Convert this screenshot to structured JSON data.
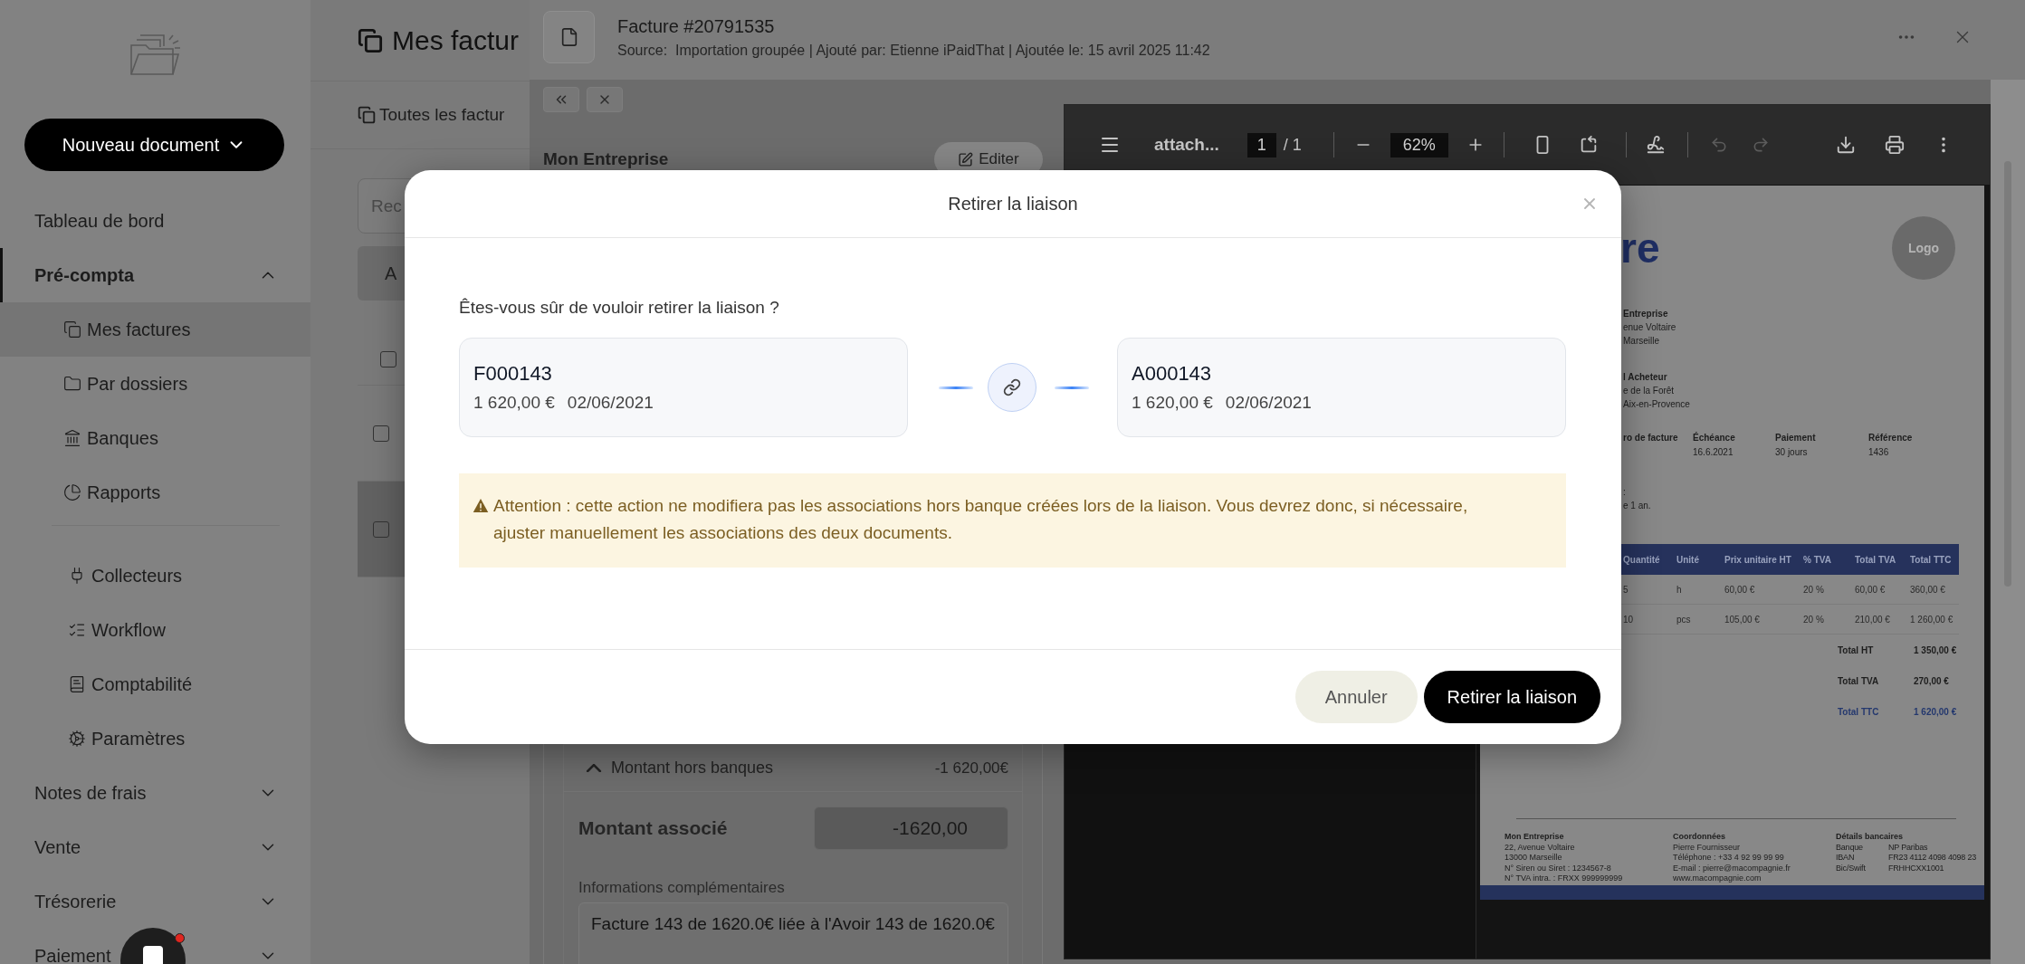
{
  "sidebar": {
    "new_document_button": "Nouveau document",
    "items": [
      {
        "label": "Tableau de bord",
        "kind": "link",
        "selected": false
      },
      {
        "label": "Pré-compta",
        "kind": "section",
        "expanded": true,
        "selected": true,
        "groups": [
          {
            "items": [
              {
                "label": "Mes factures",
                "selected": true
              },
              {
                "label": "Par dossiers",
                "selected": false
              },
              {
                "label": "Banques",
                "selected": false
              },
              {
                "label": "Rapports",
                "selected": false
              }
            ]
          },
          {
            "items": [
              {
                "label": "Collecteurs",
                "selected": false
              },
              {
                "label": "Workflow",
                "selected": false
              },
              {
                "label": "Comptabilité",
                "selected": false
              },
              {
                "label": "Paramètres",
                "selected": false
              }
            ]
          }
        ]
      },
      {
        "label": "Notes de frais",
        "kind": "section",
        "expanded": false,
        "selected": false
      },
      {
        "label": "Vente",
        "kind": "section",
        "expanded": false,
        "selected": false
      },
      {
        "label": "Trésorerie",
        "kind": "section",
        "expanded": false,
        "selected": false
      },
      {
        "label": "Paiement",
        "kind": "section",
        "expanded": false,
        "selected": false
      }
    ]
  },
  "main": {
    "page_title": "Mes factur",
    "tab": "Toutes les factur",
    "search": {
      "placeholder": "Rec"
    },
    "filter_bar": {
      "text": "A"
    },
    "table": {
      "header_checkbox": {
        "checked": false
      },
      "rows": [
        {
          "checked": false,
          "selected": false
        },
        {
          "checked": false,
          "selected": true
        }
      ]
    }
  },
  "drawer": {
    "title": "Facture #20791535",
    "subtitle": "Source:  Importation groupée | Ajouté par: Etienne iPaidThat | Ajoutée le: 15 avril 2025 11:42",
    "company": "Mon Entreprise",
    "edit_button": "Editer",
    "section": {
      "label": "Montant hors banques",
      "amount": "-1 620,00€",
      "expanded": true
    },
    "associated_amount": {
      "label": "Montant associé",
      "value": "-1620,00"
    },
    "notes": {
      "label": "Informations complémentaires",
      "value": "Facture 143 de 1620.0€ liée à l'Avoir 143 de 1620.0€"
    }
  },
  "viewer": {
    "file_name": "attach...",
    "page": "1",
    "page_count": "/ 1",
    "zoom": "62%",
    "history": [
      {
        "kind": "undo",
        "disabled": true
      },
      {
        "kind": "redo",
        "disabled": true
      }
    ]
  },
  "document": {
    "title_fragment": "re",
    "logo": "Logo",
    "seller": [
      "Entreprise",
      "enue Voltaire",
      "Marseille"
    ],
    "buyer": [
      "l Acheteur",
      "e de la Forêt",
      "Aix-en-Provence"
    ],
    "info": [
      {
        "label": "ro de facture"
      },
      {
        "label": "Échéance",
        "value": "16.6.2021"
      },
      {
        "label": "Paiement",
        "value": "30 jours"
      },
      {
        "label": "Référence",
        "value": "1436"
      }
    ],
    "note": [
      ":",
      "e 1 an."
    ],
    "items_table": {
      "columns": [
        "Quantité",
        "Unité",
        "Prix unitaire HT",
        "% TVA",
        "Total TVA",
        "Total TTC"
      ],
      "rows": [
        [
          "5",
          "h",
          "60,00 €",
          "20 %",
          "60,00 €",
          "360,00 €"
        ],
        [
          "10",
          "pcs",
          "105,00 €",
          "20 %",
          "210,00 €",
          "1 260,00 €"
        ]
      ]
    },
    "totals": [
      {
        "label": "Total HT",
        "value": "1 350,00 €",
        "highlight": false
      },
      {
        "label": "Total TVA",
        "value": "270,00 €",
        "highlight": false
      },
      {
        "label": "Total TTC",
        "value": "1 620,00 €",
        "highlight": true
      }
    ],
    "footer": [
      {
        "heading": "Mon Entreprise",
        "lines": [
          "22, Avenue Voltaire",
          "13000 Marseille",
          "N° Siren ou Siret : 1234567-8",
          "N° TVA intra. : FRXX 999999999"
        ]
      },
      {
        "heading": "Coordonnées",
        "lines": [
          "Pierre Fournisseur",
          "Téléphone : +33 4 92 99 99 99",
          "E-mail : pierre@macompagnie.fr",
          "www.macompagnie.com"
        ]
      },
      {
        "heading": "Détails bancaires",
        "pairs": [
          [
            "Banque",
            "NP Paribas"
          ],
          [
            "IBAN",
            "FR23 4112 4098 4098 23"
          ],
          [
            "Bic/Swift",
            "FRHHCXX1001"
          ]
        ]
      }
    ]
  },
  "modal": {
    "title": "Retirer la liaison",
    "question": "Êtes-vous sûr de vouloir retirer la liaison ?",
    "documents": [
      {
        "number": "F000143",
        "amount": "1 620,00 €",
        "date": "02/06/2021"
      },
      {
        "number": "A000143",
        "amount": "1 620,00 €",
        "date": "02/06/2021"
      }
    ],
    "warning": "Attention : cette action ne modifiera pas les associations hors banque créées lors de la liaison. Vous devrez donc, si nécessaire, ajuster manuellement les associations des deux documents.",
    "buttons": [
      {
        "label": "Annuler",
        "kind": "secondary"
      },
      {
        "label": "Retirer la liaison",
        "kind": "primary"
      }
    ]
  }
}
